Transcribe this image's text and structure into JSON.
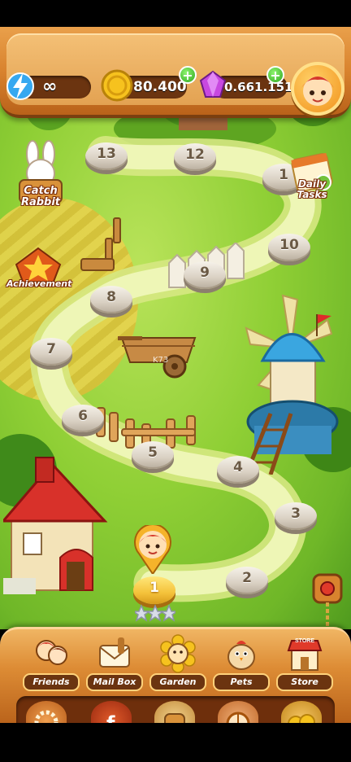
{
  "hud": {
    "lives_value": "∞",
    "coins_value": "80.400",
    "gems_value": "0.661.151"
  },
  "side_buttons": {
    "catch_rabbit": "Catch Rabbit",
    "achievement": "Achievement",
    "daily_tasks": "Daily Tasks"
  },
  "levels": [
    {
      "number": "1"
    },
    {
      "number": "2"
    },
    {
      "number": "3"
    },
    {
      "number": "4"
    },
    {
      "number": "5"
    },
    {
      "number": "6"
    },
    {
      "number": "7"
    },
    {
      "number": "8"
    },
    {
      "number": "9"
    },
    {
      "number": "10"
    },
    {
      "number": "1"
    },
    {
      "number": "12"
    },
    {
      "number": "13"
    }
  ],
  "bottom_nav": [
    {
      "label": "Friends"
    },
    {
      "label": "Mail Box"
    },
    {
      "label": "Garden"
    },
    {
      "label": "Pets"
    },
    {
      "label": "Store"
    }
  ],
  "watermark": "K73",
  "store_sign": "STORE"
}
